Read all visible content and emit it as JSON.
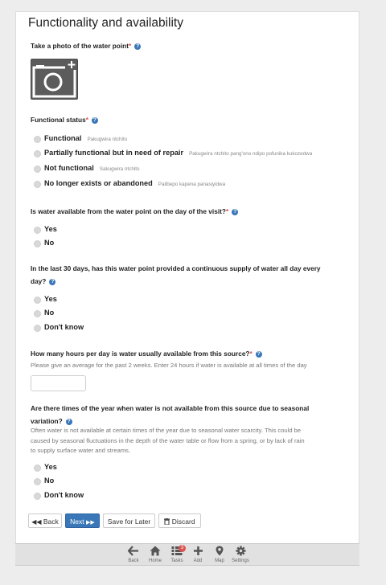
{
  "form_title": "Functionality and availability",
  "photo": {
    "label": "Take a photo of the water point",
    "required": "*",
    "icon": "camera-add-icon"
  },
  "functional_status": {
    "label": "Functional status",
    "required": "*",
    "options": [
      {
        "label": "Functional",
        "translation": "Pakugwira ntchito"
      },
      {
        "label": "Partially functional but in need of repair",
        "translation": "Pakugwira ntchito pang'ono ndipo pofunika kukozedwa"
      },
      {
        "label": "Not functional",
        "translation": "Sakugwira ntchito"
      },
      {
        "label": "No longer exists or abandoned",
        "translation": "Palibepo kapena panasiyidwa"
      }
    ]
  },
  "water_available": {
    "label": "Is water available from the water point on the day of the visit?",
    "required": "*",
    "options": [
      "Yes",
      "No"
    ]
  },
  "continuous_supply": {
    "label_line1": "In the last 30 days, has this water point provided a continuous supply of water all day every",
    "label_line2": "day?",
    "options": [
      "Yes",
      "No",
      "Don't know"
    ]
  },
  "hours_per_day": {
    "label": "How many hours per day is water usually available from this source?",
    "required": "*",
    "hint": "Please give an average for the past 2 weeks. Enter 24 hours if water is available at all times of the day",
    "value": ""
  },
  "seasonal": {
    "label_line1": "Are there times of the year when water is not available from this source due to seasonal",
    "label_line2": "variation?",
    "hint_lines": [
      "Often water is not available at certain times of the year due to seasonal water scarcity. This could be",
      "caused by seasonal fluctuations in the depth of the water table or flow from a spring, or by lack of rain",
      "to supply surface water and streams."
    ],
    "options": [
      "Yes",
      "No",
      "Don't know"
    ]
  },
  "buttons": {
    "back": "Back",
    "next": "Next",
    "save_later": "Save for Later",
    "discard": "Discard"
  },
  "nav": {
    "back": "Back",
    "home": "Home",
    "tasks": "Tasks",
    "tasks_badge": "3",
    "add": "Add",
    "map": "Map",
    "settings": "Settings"
  },
  "colors": {
    "primary": "#3a77b8",
    "required": "#d9534f",
    "badge": "#d9534f"
  }
}
